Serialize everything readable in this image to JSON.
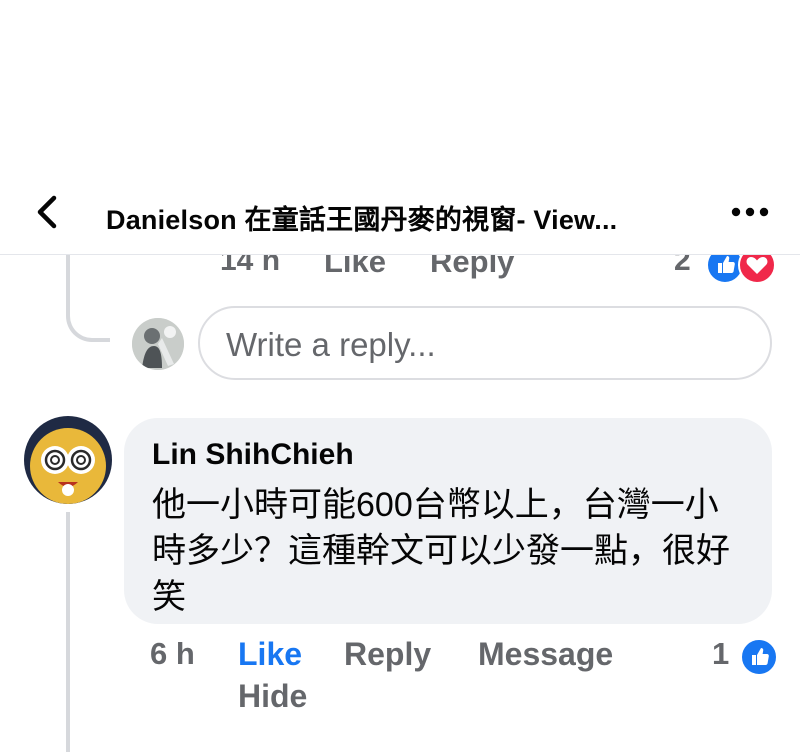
{
  "header": {
    "title": "Danielson 在童話王國丹麥的視窗- View...",
    "back_icon": "chevron-left-icon",
    "more_icon": "more-horizontal-icon"
  },
  "previous_comment": {
    "time": "14 h",
    "like_label": "Like",
    "reply_label": "Reply",
    "reaction_count": "2",
    "reactions": [
      "like-reaction-icon",
      "love-reaction-icon"
    ]
  },
  "reply_box": {
    "placeholder": "Write a reply..."
  },
  "comment": {
    "author": "Lin ShihChieh",
    "text": "他一小時可能600台幣以上，台灣一小時多少？這種幹文可以少發一點，很好笑",
    "time": "6 h",
    "like_label": "Like",
    "reply_label": "Reply",
    "message_label": "Message",
    "hide_label": "Hide",
    "reaction_count": "1",
    "reactions": [
      "like-reaction-icon"
    ]
  },
  "colors": {
    "accent": "#1877f2",
    "love": "#f0284a",
    "muted_text": "#65676b",
    "bubble_bg": "#f0f2f5"
  }
}
